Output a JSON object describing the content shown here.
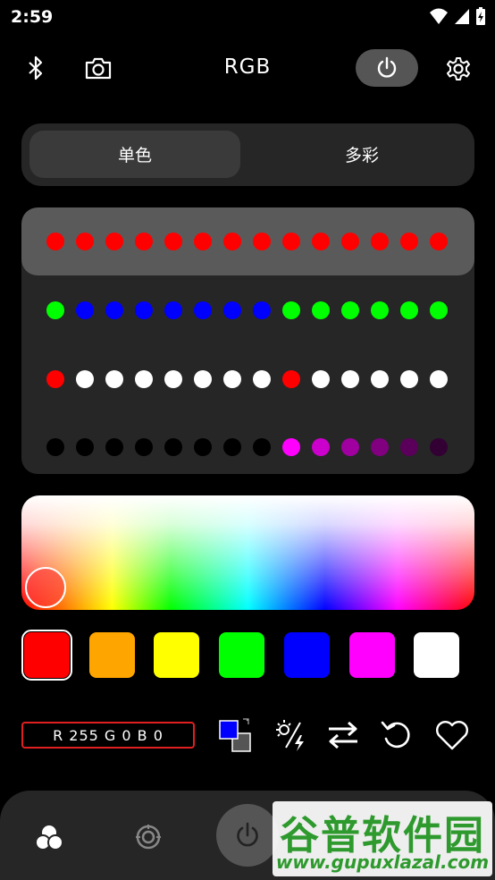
{
  "status": {
    "time": "2:59"
  },
  "header": {
    "title": "RGB"
  },
  "mode_tabs": [
    {
      "label": "单色"
    },
    {
      "label": "多彩"
    }
  ],
  "presets": [
    {
      "colors": [
        "#ff0000",
        "#ff0000",
        "#ff0000",
        "#ff0000",
        "#ff0000",
        "#ff0000",
        "#ff0000",
        "#ff0000",
        "#ff0000",
        "#ff0000",
        "#ff0000",
        "#ff0000",
        "#ff0000",
        "#ff0000"
      ]
    },
    {
      "colors": [
        "#00ff00",
        "#0000ff",
        "#0000ff",
        "#0000ff",
        "#0000ff",
        "#0000ff",
        "#0000ff",
        "#0000ff",
        "#00ff00",
        "#00ff00",
        "#00ff00",
        "#00ff00",
        "#00ff00",
        "#00ff00"
      ]
    },
    {
      "colors": [
        "#ff0000",
        "#ffffff",
        "#ffffff",
        "#ffffff",
        "#ffffff",
        "#ffffff",
        "#ffffff",
        "#ffffff",
        "#ff0000",
        "#ffffff",
        "#ffffff",
        "#ffffff",
        "#ffffff",
        "#ffffff"
      ]
    },
    {
      "colors": [
        "#000000",
        "#000000",
        "#000000",
        "#000000",
        "#000000",
        "#000000",
        "#000000",
        "#000000",
        "#ff00ff",
        "#cc00cc",
        "#a000a0",
        "#800080",
        "#5a005a",
        "#330033"
      ]
    }
  ],
  "swatches": [
    "#ff0000",
    "#ffa500",
    "#ffff00",
    "#00ff00",
    "#0000ff",
    "#ff00ff",
    "#ffffff"
  ],
  "rgb_readout": "R 255   G 0   B 0",
  "colors": {
    "accent_border": "#e02020",
    "panel": "#262626",
    "selected_row": "#5a5a5a"
  },
  "watermark": {
    "title": "谷普软件园",
    "url": "www.gupuxlazal.com"
  }
}
